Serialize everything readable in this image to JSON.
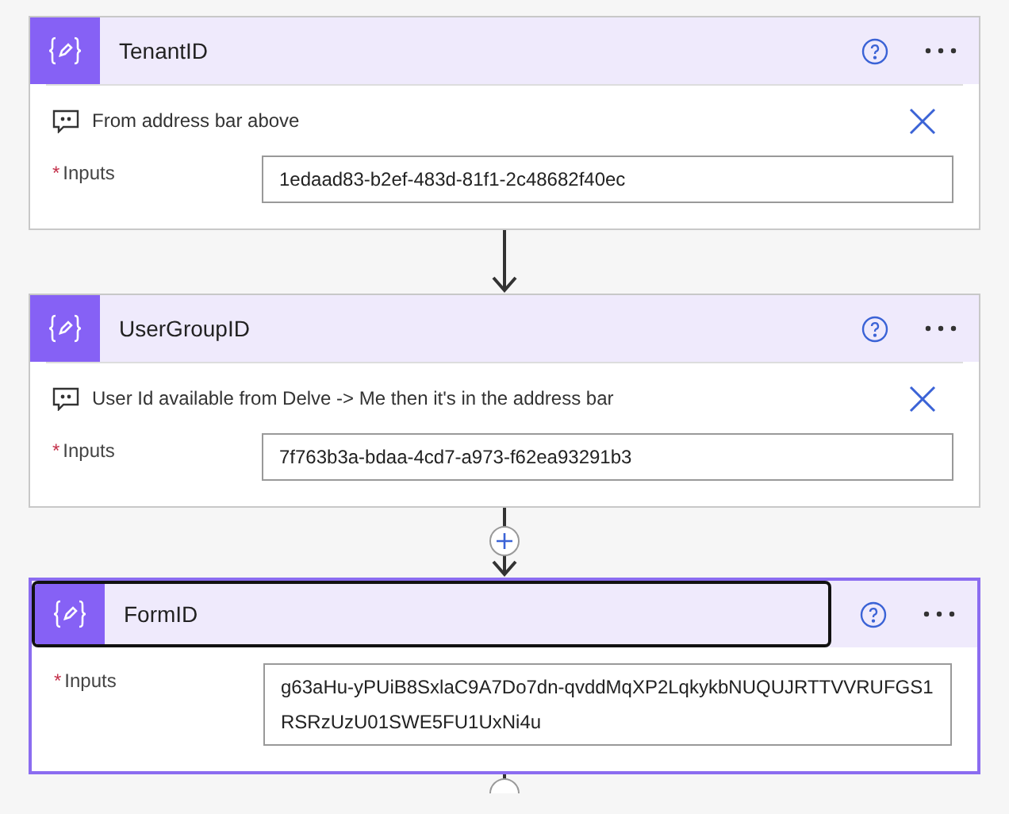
{
  "cards": [
    {
      "title": "TenantID",
      "selected": false,
      "comment": "From address bar above",
      "input_label": "Inputs",
      "required_mark": "*",
      "input_value": "1edaad83-b2ef-483d-81f1-2c48682f40ec",
      "connector": {
        "kind": "arrow"
      }
    },
    {
      "title": "UserGroupID",
      "selected": false,
      "comment": "User Id available from Delve -> Me then it's in the address bar",
      "input_label": "Inputs",
      "required_mark": "*",
      "input_value": "7f763b3a-bdaa-4cd7-a973-f62ea93291b3",
      "connector": {
        "kind": "plus"
      }
    },
    {
      "title": "FormID",
      "selected": true,
      "input_label": "Inputs",
      "required_mark": "*",
      "input_value": "g63aHu-yPUiB8SxlaC9A7Do7dn-qvddMqXP2LqkykbNUQUJRTTVVRUFGS1RSRzUzU01SWE5FU1UxNi4u",
      "connector": {
        "kind": "end"
      }
    }
  ]
}
